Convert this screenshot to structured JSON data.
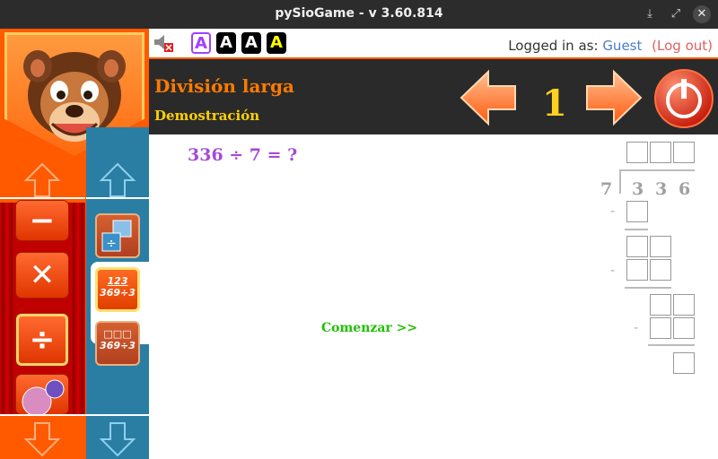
{
  "window": {
    "title": "pySioGame - v 3.60.814"
  },
  "topbar": {
    "font_buttons": [
      "A",
      "A",
      "A",
      "A"
    ],
    "logged_in_label": "Logged in as:",
    "user": "Guest",
    "logout": "(Log out)"
  },
  "header": {
    "title": "División larga",
    "subtitle": "Demostración",
    "level": "1"
  },
  "main": {
    "question": "336 ÷ 7 = ?",
    "start_link": "Comenzar >>",
    "divisor": "7",
    "dividend_digits": [
      "3",
      "3",
      "6"
    ],
    "minus_sign": "-"
  },
  "sidebar": {
    "operations": [
      "−",
      "✕",
      "÷"
    ],
    "game1_lines": [
      "123",
      "369÷3"
    ],
    "game2_lines": [
      "□□□",
      "369÷3"
    ]
  },
  "colors": {
    "accent_orange": "#ff5a00",
    "panel_blue": "#2a7ea4",
    "title_orange": "#ff7a00",
    "subtitle_yellow": "#ffd000",
    "question_purple": "#a64ad6",
    "start_green": "#20c000"
  },
  "icons": {
    "window_buttons": [
      "download-icon",
      "maximize-icon",
      "close-icon"
    ],
    "nav": [
      "arrow-left-icon",
      "arrow-right-icon",
      "power-icon"
    ]
  }
}
